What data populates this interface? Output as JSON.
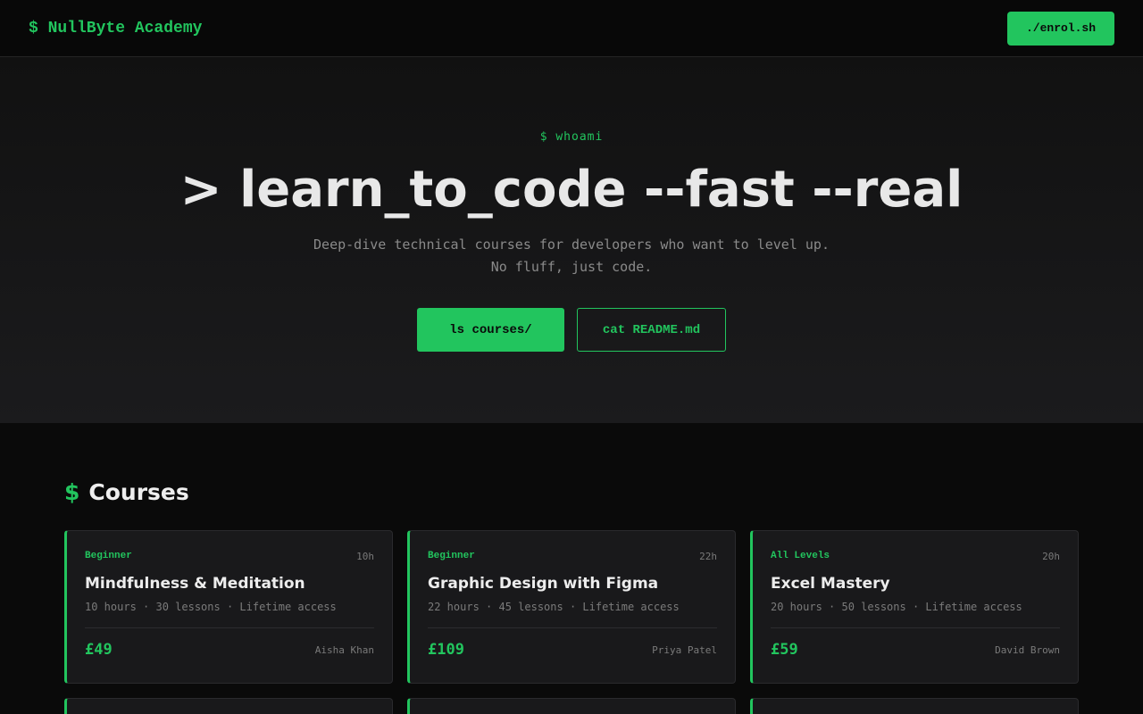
{
  "nav": {
    "brand": "$ NullByte Academy",
    "enrol_label": "./enrol.sh"
  },
  "hero": {
    "command": "$ whoami",
    "title": "> learn_to_code --fast --real",
    "subtitle_line1": "Deep-dive technical courses for developers who want to level up.",
    "subtitle_line2": "No fluff, just code.",
    "primary_cta": "ls courses/",
    "secondary_cta": "cat README.md"
  },
  "courses_section": {
    "prompt": "$",
    "title": "Courses"
  },
  "courses": [
    {
      "level": "Beginner",
      "duration_badge": "10h",
      "title": "Mindfulness & Meditation",
      "meta": "10 hours · 30 lessons · Lifetime access",
      "price": "£49",
      "instructor": "Aisha Khan"
    },
    {
      "level": "Beginner",
      "duration_badge": "22h",
      "title": "Graphic Design with Figma",
      "meta": "22 hours · 45 lessons · Lifetime access",
      "price": "£109",
      "instructor": "Priya Patel"
    },
    {
      "level": "All Levels",
      "duration_badge": "20h",
      "title": "Excel Mastery",
      "meta": "20 hours · 50 lessons · Lifetime access",
      "price": "£59",
      "instructor": "David Brown"
    }
  ],
  "colors": {
    "accent": "#22c55e",
    "background": "#0a0a0a",
    "card_background": "#19191b"
  }
}
